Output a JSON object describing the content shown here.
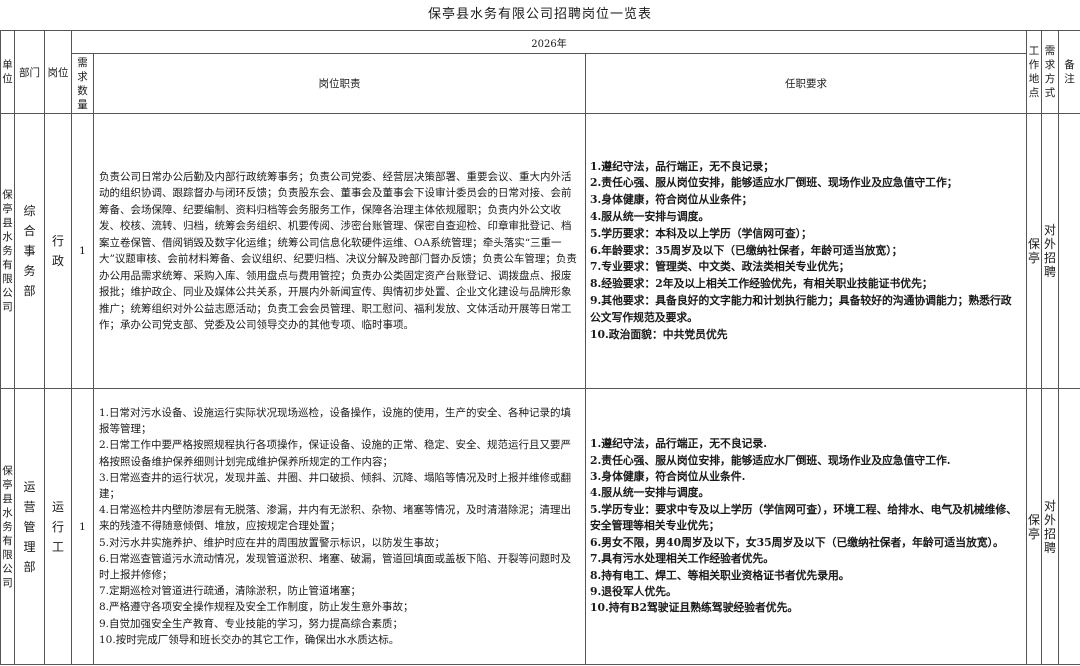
{
  "title": "保亭县水务有限公司招聘岗位一览表",
  "year_header": "2026年",
  "headers": {
    "unit": "单位",
    "dept": "部门",
    "post": "岗位",
    "count": "需求数量",
    "duties": "岗位职责",
    "requirements": "任职要求",
    "location": "工作地点",
    "method": "需求方式",
    "remark": "备注"
  },
  "rows": [
    {
      "unit": "保亭县水务有限公司",
      "dept": "综合事务部",
      "post": "行政",
      "count": "1",
      "duties": "负责公司日常办公后勤及内部行政统筹事务；负责公司党委、经营层决策部署、重要会议、重大内外活动的组织协调、跟踪督办与闭环反馈；负责股东会、董事会及董事会下设审计委员会的日常对接、会前筹备、会场保障、纪要编制、资料归档等会务服务工作，保障各治理主体依规履职；负责内外公文收发、校核、流转、归档，统筹会务组织、机要传阅、涉密台账管理、保密自查迎检、印章审批登记、档案立卷保管、借阅销毁及数字化运维；统筹公司信息化软硬件运维、OA系统管理；牵头落实“三重一大”议题审核、会前材料筹备、会议组织、纪要归档、决议分解及跨部门督办反馈；负责公车管理；负责办公用品需求统筹、采购入库、领用盘点与费用管控；负责办公类固定资产台账登记、调拨盘点、报废报批；维护政企、同业及媒体公共关系，开展内外新闻宣传、舆情初步处置、企业文化建设与品牌形象推广；统筹组织对外公益志愿活动；负责工会会员管理、职工慰问、福利发放、文体活动开展等日常工作；承办公司党支部、党委及公司领导交办的其他专项、临时事项。",
      "requirements": [
        "1.遵纪守法，品行端正，无不良记录；",
        "2.责任心强、服从岗位安排，能够适应水厂倒班、现场作业及应急值守工作；",
        "3.身体健康，符合岗位从业条件；",
        "4.服从统一安排与调度。",
        "5.学历要求：本科及以上学历（学信网可查）；",
        "6.年龄要求：35周岁及以下（已缴纳社保者，年龄可适当放宽）；",
        "7.专业要求：管理类、中文类、政法类相关专业优先；",
        "8.经验要求：2年及以上相关工作经验优先，有相关职业技能证书优先；",
        "9.其他要求：具备良好的文字能力和计划执行能力；具备较好的沟通协调能力；熟悉行政公文写作规范及要求。",
        "10.政治面貌：中共党员优先"
      ],
      "location": "保亭",
      "method": "对外招聘",
      "remark": ""
    },
    {
      "unit": "保亭县水务有限公司",
      "dept": "运营管理部",
      "post": "运行工",
      "count": "1",
      "duties": [
        "1.日常对污水设备、设施运行实际状况现场巡检，设备操作，设施的使用，生产的安全、各种记录的填报等管理；",
        "2.日常工作中要严格按照规程执行各项操作，保证设备、设施的正常、稳定、安全、规范运行且又要严格按照设备维护保养细则计划完成维护保养所规定的工作内容；",
        "3.日常巡查井的运行状况，发现井盖、井圈、井口破损、倾斜、沉降、塌陷等情况及时上报并维修或翻建；",
        "4.日常巡检井内壁防渗层有无脱落、渗漏，井内有无淤积、杂物、堵塞等情况，及时清潜除泥；清理出来的残渣不得随意倾倒、堆放，应按规定合理处置；",
        "5.对污水井实施养护、维护时应在井的周围放置警示标识，以防发生事故；",
        "6.日常巡查管道污水流动情况，发现管道淤积、堵塞、破漏，管道回填面或盖板下陷、开裂等问题时及时上报并修修；",
        "7.定期巡检对管道进行疏通，清除淤积，防止管道堵塞；",
        "8.严格遵守各项安全操作规程及安全工作制度，防止发生意外事故；",
        "9.自觉加强安全生产教育、专业技能的学习，努力提高综合素质；",
        "10.按时完成厂领导和班长交办的其它工作，确保出水水质达标。"
      ],
      "requirements": [
        "1.遵纪守法，品行端正，无不良记录.",
        "2.责任心强、服从岗位安排，能够适应水厂倒班、现场作业及应急值守工作.",
        "3.身体健康，符合岗位从业条件.",
        "4.服从统一安排与调度。",
        "5.学历专业：要求中专及以上学历（学信网可查），环境工程、给排水、电气及机械维修、安全管理等相关专业优先；",
        "6.男女不限，男40周岁及以下，女35周岁及以下（已缴纳社保者，年龄可适当放宽）。",
        "7.具有污水处理相关工作经验者优先。",
        "8.持有电工、焊工、等相关职业资格证书者优先录用。",
        "9.退役军人优先。",
        "10.持有B2驾驶证且熟练驾驶经验者优先。"
      ],
      "location": "保亭",
      "method": "对外招聘",
      "remark": ""
    }
  ]
}
